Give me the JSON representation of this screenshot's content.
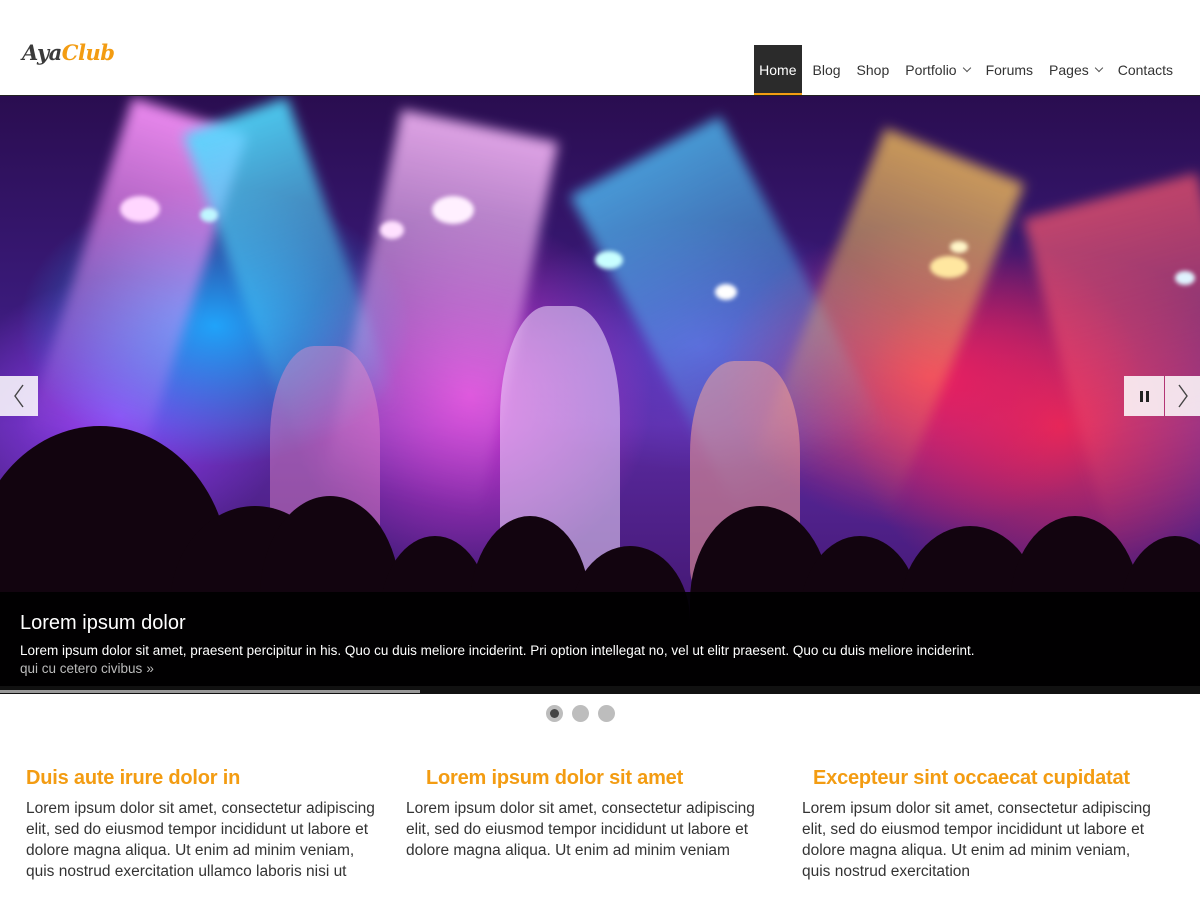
{
  "logo": {
    "part1": "Aya",
    "part2": "Club"
  },
  "nav": {
    "items": [
      {
        "label": "Home",
        "active": true
      },
      {
        "label": "Blog"
      },
      {
        "label": "Shop"
      },
      {
        "label": "Portfolio",
        "has_dropdown": true
      },
      {
        "label": "Forums"
      },
      {
        "label": "Pages",
        "has_dropdown": true
      },
      {
        "label": "Contacts"
      }
    ]
  },
  "slider": {
    "caption_title": "Lorem ipsum dolor",
    "caption_text": "Lorem ipsum dolor sit amet, praesent percipitur in his. Quo cu duis meliore inciderint. Pri option intellegat no, vel ut elitr praesent. Quo cu duis meliore inciderint.",
    "caption_link": "qui cu cetero civibus",
    "progress_fraction": 0.35,
    "slide_count": 3,
    "active_slide": 1
  },
  "features": [
    {
      "title": "Duis aute irure dolor in",
      "text": "Lorem ipsum dolor sit amet, consectetur adipiscing elit, sed do eiusmod tempor incididunt ut labore et dolore magna aliqua. Ut enim ad minim veniam, quis nostrud exercitation ullamco laboris nisi ut"
    },
    {
      "title": "Lorem ipsum dolor sit amet",
      "text": "Lorem ipsum dolor sit amet, consectetur adipiscing elit, sed do eiusmod tempor incididunt ut labore et dolore magna aliqua. Ut enim ad minim veniam"
    },
    {
      "title": "Excepteur sint occaecat cupidatat",
      "text": "Lorem ipsum dolor sit amet, consectetur adipiscing elit, sed do eiusmod tempor incididunt ut labore et dolore magna aliqua. Ut enim ad minim veniam, quis nostrud exercitation"
    }
  ],
  "colors": {
    "accent": "#f39c12",
    "nav_active_bg": "#2b2b2b"
  }
}
